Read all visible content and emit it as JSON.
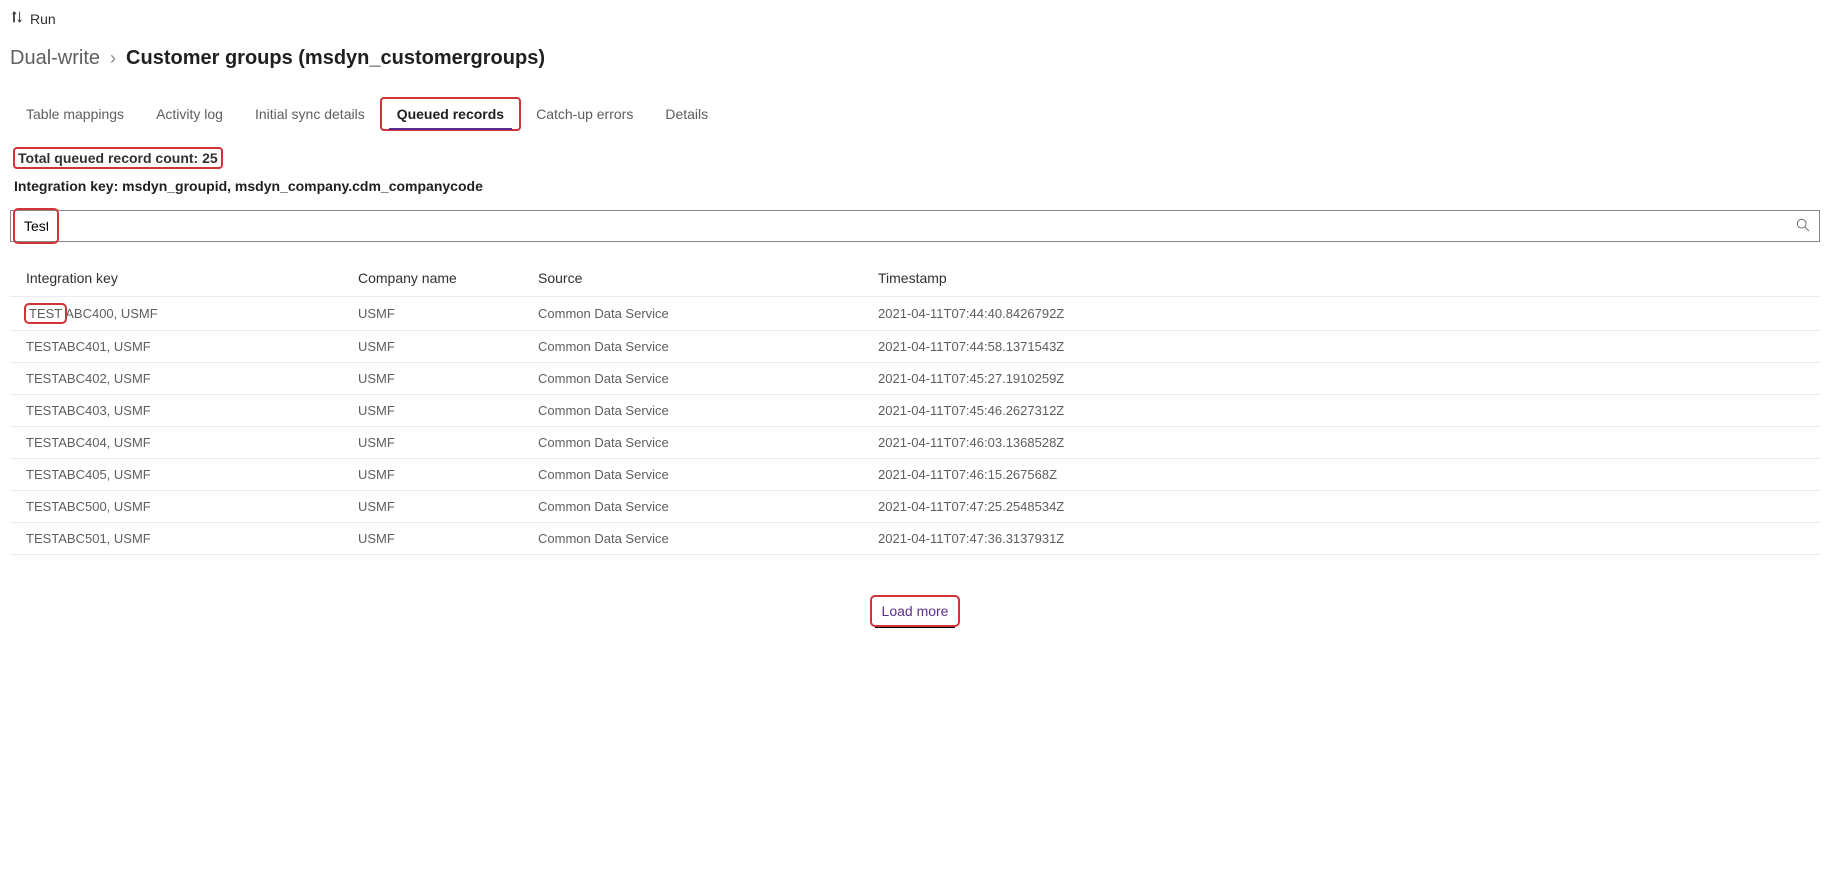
{
  "toolbar": {
    "run_label": "Run"
  },
  "breadcrumb": {
    "root": "Dual-write",
    "current": "Customer groups (msdyn_customergroups)"
  },
  "tabs": [
    {
      "label": "Table mappings",
      "active": false
    },
    {
      "label": "Activity log",
      "active": false
    },
    {
      "label": "Initial sync details",
      "active": false
    },
    {
      "label": "Queued records",
      "active": true
    },
    {
      "label": "Catch-up errors",
      "active": false
    },
    {
      "label": "Details",
      "active": false
    }
  ],
  "meta": {
    "total_count_line": "Total queued record count: 25",
    "integration_key_line": "Integration key: msdyn_groupid, msdyn_company.cdm_companycode"
  },
  "search": {
    "value": "Test"
  },
  "table": {
    "headers": [
      "Integration key",
      "Company name",
      "Source",
      "Timestamp"
    ],
    "rows": [
      {
        "key_hl": "TEST",
        "key_rest": "ABC400, USMF",
        "company": "USMF",
        "source": "Common Data Service",
        "ts": "2021-04-11T07:44:40.8426792Z"
      },
      {
        "key_hl": "",
        "key_rest": "TESTABC401, USMF",
        "company": "USMF",
        "source": "Common Data Service",
        "ts": "2021-04-11T07:44:58.1371543Z"
      },
      {
        "key_hl": "",
        "key_rest": "TESTABC402, USMF",
        "company": "USMF",
        "source": "Common Data Service",
        "ts": "2021-04-11T07:45:27.1910259Z"
      },
      {
        "key_hl": "",
        "key_rest": "TESTABC403, USMF",
        "company": "USMF",
        "source": "Common Data Service",
        "ts": "2021-04-11T07:45:46.2627312Z"
      },
      {
        "key_hl": "",
        "key_rest": "TESTABC404, USMF",
        "company": "USMF",
        "source": "Common Data Service",
        "ts": "2021-04-11T07:46:03.1368528Z"
      },
      {
        "key_hl": "",
        "key_rest": "TESTABC405, USMF",
        "company": "USMF",
        "source": "Common Data Service",
        "ts": "2021-04-11T07:46:15.267568Z"
      },
      {
        "key_hl": "",
        "key_rest": "TESTABC500, USMF",
        "company": "USMF",
        "source": "Common Data Service",
        "ts": "2021-04-11T07:47:25.2548534Z"
      },
      {
        "key_hl": "",
        "key_rest": "TESTABC501, USMF",
        "company": "USMF",
        "source": "Common Data Service",
        "ts": "2021-04-11T07:47:36.3137931Z"
      }
    ]
  },
  "loadmore": {
    "label": "Load more"
  }
}
